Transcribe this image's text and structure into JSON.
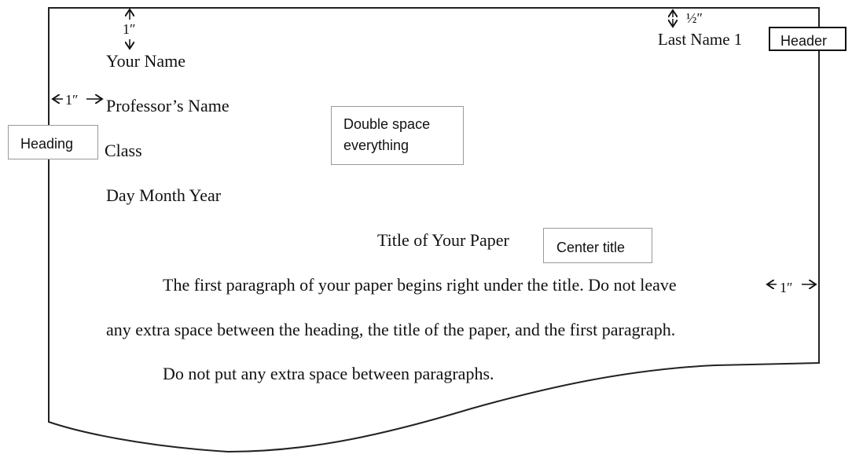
{
  "header": {
    "text": "Last Name 1",
    "margin_label": "½″",
    "callout": "Header"
  },
  "margins": {
    "top": "1″",
    "left": "1″",
    "right": "1″"
  },
  "heading": {
    "lines": [
      "Your Name",
      "Professor’s Name",
      "Class",
      "Day Month Year"
    ],
    "callout": "Heading"
  },
  "spacing_callout": "Double space everything",
  "title": {
    "text": "Title of Your Paper",
    "callout": "Center title"
  },
  "body": {
    "paragraph1_line1": "The first paragraph of your paper begins right under the title.  Do not leave",
    "paragraph1_line2": "any extra space between the heading, the title of the paper, and the first paragraph.",
    "paragraph2_line1": "Do not put any extra space between paragraphs."
  }
}
